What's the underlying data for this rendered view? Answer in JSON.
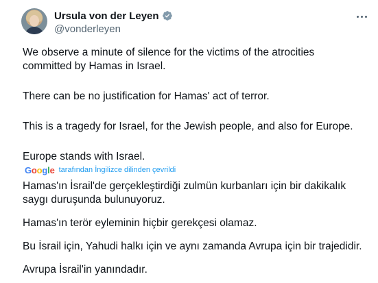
{
  "author": {
    "display_name": "Ursula von der Leyen",
    "handle": "@vonderleyen",
    "verified": true,
    "verified_color": "#829aab"
  },
  "original_text": {
    "p1": "We observe a minute of silence for the victims of the atrocities\ncommitted by Hamas in Israel.",
    "p2": "There can be no justification for Hamas' act of terror.",
    "p3": "This is a tragedy for Israel, for the Jewish people, and also for Europe.",
    "p4": "Europe stands with Israel."
  },
  "translation": {
    "provider": "Google",
    "label": "tarafından İngilizce dilinden çevrildi",
    "link_color": "#1d9bf0"
  },
  "translated_text": {
    "p1": "Hamas'ın İsrail'de gerçekleştirdiği zulmün kurbanları için bir dakikalık\nsaygı duruşunda bulunuyoruz.",
    "p2": "Hamas'ın terör eyleminin hiçbir gerekçesi olamaz.",
    "p3": "Bu İsrail için, Yahudi halkı için ve aynı zamanda Avrupa için bir trajedidir.",
    "p4": "Avrupa İsrail'in yanındadır."
  },
  "icons": {
    "more": "more-horizontal-icon",
    "verified": "verified-badge-icon"
  }
}
